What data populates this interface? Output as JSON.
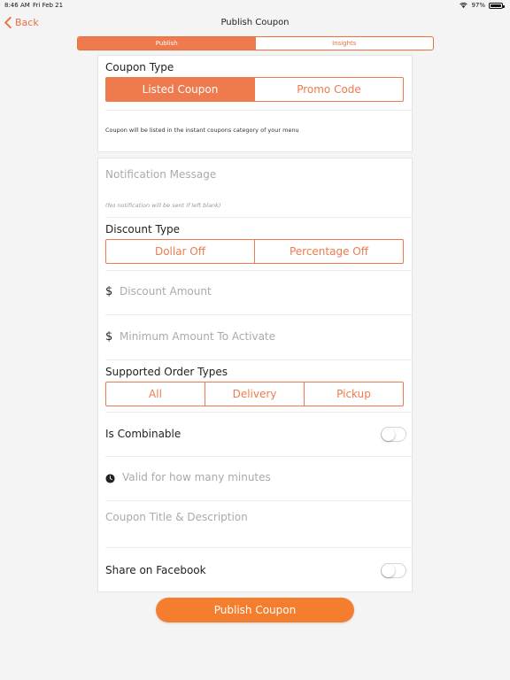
{
  "status_bar": {
    "time": "8:46 AM",
    "date": "Fri Feb 21",
    "battery": "97%",
    "battery_level": 0.97
  },
  "nav": {
    "back_label": "Back",
    "title": "Publish Coupon"
  },
  "tabs": [
    {
      "label": "Publish",
      "active": true
    },
    {
      "label": "Insights",
      "active": false
    }
  ],
  "coupon_type": {
    "label": "Coupon Type",
    "options": [
      {
        "label": "Listed Coupon",
        "selected": true
      },
      {
        "label": "Promo Code",
        "selected": false
      }
    ],
    "info": "Coupon will be listed in the instant coupons category of your menu"
  },
  "notification": {
    "placeholder": "Notification Message",
    "hint": "(No notification will be sent if left blank)"
  },
  "discount_type": {
    "label": "Discount Type",
    "options": [
      {
        "label": "Dollar Off",
        "selected": false
      },
      {
        "label": "Percentage Off",
        "selected": false
      }
    ]
  },
  "discount_amount": {
    "currency_symbol": "$",
    "placeholder": "Discount Amount"
  },
  "minimum_amount": {
    "currency_symbol": "$",
    "placeholder": "Minimum Amount To Activate"
  },
  "order_types": {
    "label": "Supported Order Types",
    "options": [
      {
        "label": "All",
        "selected": false
      },
      {
        "label": "Delivery",
        "selected": false
      },
      {
        "label": "Pickup",
        "selected": false
      }
    ]
  },
  "combinable": {
    "label": "Is Combinable",
    "on": false
  },
  "valid_minutes": {
    "placeholder": "Valid for how many minutes"
  },
  "coupon_title": {
    "placeholder": "Coupon Title & Description"
  },
  "facebook": {
    "label": "Share on Facebook",
    "on": false
  },
  "publish_button": {
    "label": "Publish Coupon"
  },
  "colors": {
    "accent": "#ef7a4d",
    "button": "#f47e2d"
  }
}
